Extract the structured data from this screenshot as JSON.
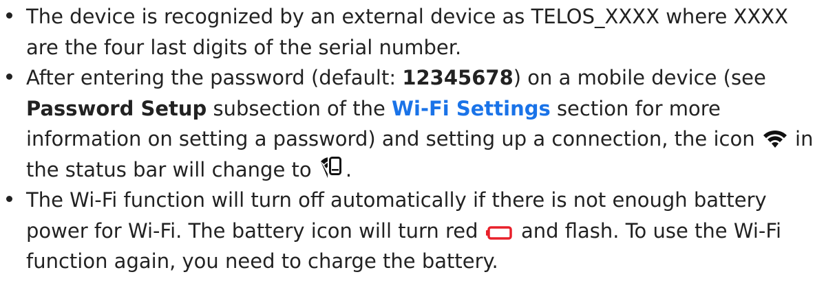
{
  "items": [
    {
      "text": "The device is recognized by an external device as TELOS_XXXX where XXXX are the four last digits of the serial number."
    },
    {
      "part1": "After entering the password (default: ",
      "password": "12345678",
      "part2": ") on a mobile device (see ",
      "subsection": "Password Setup",
      "part3": " subsection of the ",
      "section_link": "Wi-Fi Settings",
      "part4": " section for more information on setting a password) and setting up a connection, the icon ",
      "part5": " in the status bar will change to ",
      "part6": ".",
      "icon_from": "wifi-icon",
      "icon_to": "wifi-phone-icon"
    },
    {
      "part1": "The Wi-Fi function will turn off automatically if there is not enough battery power for Wi-Fi. The battery icon will turn red ",
      "part2": " and flash. To use the Wi-Fi function again, you need to charge the battery.",
      "icon": "battery-low-icon",
      "icon_color": "#e8202a"
    }
  ],
  "colors": {
    "text": "#222222",
    "link": "#1a73e8",
    "battery_red": "#e8202a"
  }
}
